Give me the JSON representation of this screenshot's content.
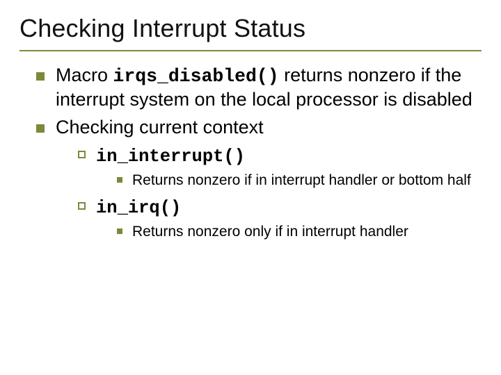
{
  "title": "Checking Interrupt Status",
  "b1": {
    "pre": "Macro ",
    "code": "irqs_disabled()",
    "post": " returns nonzero if the interrupt system on the local processor is disabled"
  },
  "b2": {
    "text": "Checking current context",
    "s1": {
      "code": "in_interrupt()",
      "desc": "Returns nonzero if in interrupt handler or bottom half"
    },
    "s2": {
      "code": "in_irq()",
      "desc": "Returns nonzero only if in interrupt handler"
    }
  }
}
